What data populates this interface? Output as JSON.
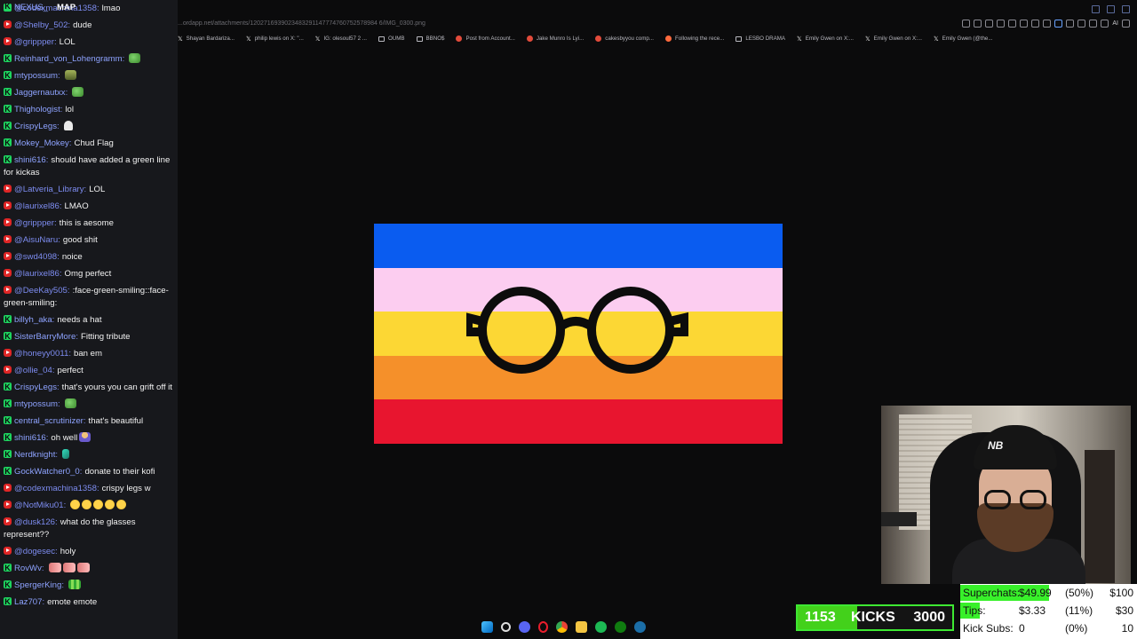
{
  "stream_title": "NEXUS_",
  "stream_subtitle": "MAP",
  "browser": {
    "url": "...ordapp.net/attachments/1202716939023483291147774760752578984 6/IMG_0300.png",
    "bookmarks": [
      {
        "icon": "x",
        "label": "Shayan Bardarizа..."
      },
      {
        "icon": "x",
        "label": "philip lewis on X: \"..."
      },
      {
        "icon": "x",
        "label": "IG: olesoul57 2 ..."
      },
      {
        "icon": "folder",
        "label": "OUMB"
      },
      {
        "icon": "folder",
        "label": "BBNO$"
      },
      {
        "icon": "red",
        "label": "Post from Account..."
      },
      {
        "icon": "red",
        "label": "Jake Munro Is Lyi..."
      },
      {
        "icon": "red",
        "label": "cakesbyyou comp..."
      },
      {
        "icon": "orange",
        "label": "Following the rece..."
      },
      {
        "icon": "folder",
        "label": "LESBO DRAMA"
      },
      {
        "icon": "x",
        "label": "Emily Gwen on X:..."
      },
      {
        "icon": "x",
        "label": "Emily Gwen on X:..."
      },
      {
        "icon": "x",
        "label": "Emily Gwen (@the..."
      }
    ],
    "toolbar_ai_label": "AI"
  },
  "chat": [
    {
      "platform": "yt",
      "user": "@codexmachina1358",
      "text": "lmao"
    },
    {
      "platform": "yt",
      "user": "@Shelby_502",
      "text": "dude"
    },
    {
      "platform": "yt",
      "user": "@grippper",
      "text": "LOL"
    },
    {
      "platform": "kick",
      "user": "Reinhard_von_Lohengramm",
      "text": "",
      "emote": "frog"
    },
    {
      "platform": "kick",
      "user": "mtypossum",
      "text": "",
      "emote": "tank"
    },
    {
      "platform": "kick",
      "user": "Jaggernautxx",
      "text": "",
      "emote": "frog"
    },
    {
      "platform": "kick",
      "user": "Thighologist",
      "text": "lol"
    },
    {
      "platform": "kick",
      "user": "CrispyLegs",
      "text": "",
      "emote": "ghost"
    },
    {
      "platform": "kick",
      "user": "Mokey_Mokey",
      "text": "Chud Flag"
    },
    {
      "platform": "kick",
      "user": "shini616",
      "text": "should have added a green line for kickas"
    },
    {
      "platform": "yt",
      "user": "@Latveria_Library",
      "text": "LOL"
    },
    {
      "platform": "yt",
      "user": "@laurixel86",
      "text": "LMAO"
    },
    {
      "platform": "yt",
      "user": "@grippper",
      "text": "this is aesome"
    },
    {
      "platform": "yt",
      "user": "@AisuNaru",
      "text": "good shit"
    },
    {
      "platform": "yt",
      "user": "@swd4098",
      "text": "noice"
    },
    {
      "platform": "yt",
      "user": "@laurixel86",
      "text": "Omg perfect"
    },
    {
      "platform": "yt",
      "user": "@DeeKay505",
      "text": ":face-green-smiling::face-green-smiling:"
    },
    {
      "platform": "kick",
      "user": "billyh_aka",
      "text": "needs a hat"
    },
    {
      "platform": "kick",
      "user": "SisterBarryMore",
      "text": "Fitting tribute"
    },
    {
      "platform": "yt",
      "user": "@honeyy0011",
      "text": "ban em"
    },
    {
      "platform": "yt",
      "user": "@ollie_04",
      "text": "perfect"
    },
    {
      "platform": "kick",
      "user": "CrispyLegs",
      "text": "that's yours you can grift off it"
    },
    {
      "platform": "kick",
      "user": "mtypossum",
      "text": "",
      "emote": "frog"
    },
    {
      "platform": "kick",
      "user": "central_scrutinizer",
      "text": "that's beautiful"
    },
    {
      "platform": "kick",
      "user": "shini616",
      "text": "oh well",
      "emote": "person"
    },
    {
      "platform": "kick",
      "user": "Nerdknight",
      "text": "",
      "emote": "feather"
    },
    {
      "platform": "kick",
      "user": "GockWatcher0_0",
      "text": "donate to their kofi"
    },
    {
      "platform": "yt",
      "user": "@codexmachina1358",
      "text": "crispy legs w"
    },
    {
      "platform": "yt",
      "user": "@NotMiku01",
      "text": "",
      "emote": "face",
      "emote_count": 5
    },
    {
      "platform": "yt",
      "user": "@dusk126",
      "text": "what do the glasses represent??"
    },
    {
      "platform": "yt",
      "user": "@dogesec",
      "text": "holy"
    },
    {
      "platform": "kick",
      "user": "RovWv",
      "text": "",
      "emote": "pink",
      "emote_count": 3
    },
    {
      "platform": "kick",
      "user": "SpergerKing",
      "text": "",
      "emote": "pixel"
    },
    {
      "platform": "kick",
      "user": "Laz707",
      "text": "emote emote"
    }
  ],
  "flag": {
    "stripes": [
      "#0a5cf0",
      "#fccdf0",
      "#fcd734",
      "#f5902a",
      "#e8152f"
    ],
    "glasses_color": "#0c0c0c"
  },
  "kicks": {
    "current": "1153",
    "label": "KICKS",
    "target": "3000",
    "progress": 0.384
  },
  "goals": [
    {
      "name": "Superchats:",
      "value": "$49.99",
      "percent": "(50%)",
      "target": "$100",
      "progress": 0.5
    },
    {
      "name": "Tips:",
      "value": "$3.33",
      "percent": "(11%)",
      "target": "$30",
      "progress": 0.11
    },
    {
      "name": "Kick Subs:",
      "value": "0",
      "percent": "(0%)",
      "target": "10",
      "progress": 0
    }
  ],
  "taskbar": [
    "windows-icon",
    "search-icon",
    "discord-icon",
    "opera-icon",
    "chrome-icon",
    "file-explorer-icon",
    "spotify-icon",
    "xbox-icon",
    "steam-icon"
  ]
}
